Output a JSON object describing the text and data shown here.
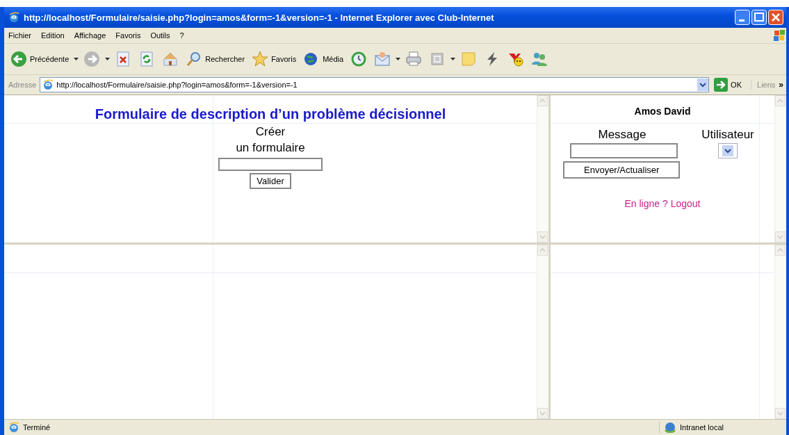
{
  "window": {
    "title": "http://localhost/Formulaire/saisie.php?login=amos&form=-1&version=-1 - Internet Explorer avec Club-Internet"
  },
  "menu": [
    "Fichier",
    "Edition",
    "Affichage",
    "Favoris",
    "Outils",
    "?"
  ],
  "toolbar": [
    {
      "kind": "back",
      "label": "Précédente",
      "menu_arrow": true
    },
    {
      "kind": "forward",
      "menu_arrow": true
    },
    {
      "kind": "stop"
    },
    {
      "kind": "refresh"
    },
    {
      "kind": "home"
    },
    {
      "kind": "search",
      "label": "Rechercher"
    },
    {
      "kind": "favorites",
      "label": "Favoris"
    },
    {
      "kind": "media",
      "label": "Média"
    },
    {
      "kind": "history"
    },
    {
      "kind": "mail",
      "menu_arrow": true
    },
    {
      "kind": "print"
    },
    {
      "kind": "edit",
      "menu_arrow": true
    },
    {
      "kind": "note"
    },
    {
      "kind": "bolt"
    },
    {
      "kind": "smiley"
    },
    {
      "kind": "people"
    }
  ],
  "address": {
    "label": "Adresse",
    "value": "http://localhost/Formulaire/saisie.php?login=amos&form=-1&version=-1",
    "go": "OK",
    "links": "Liens",
    "more": "»"
  },
  "form_frame": {
    "heading": "Formulaire de description d’un problème décisionnel",
    "prompt": [
      "Créer",
      "un formulaire"
    ],
    "button": "Valider"
  },
  "chat_frame": {
    "user": "Amos David",
    "message_label": "Message",
    "user_label": "Utilisateur",
    "send_button": "Envoyer/Actualiser",
    "status_link": "En ligne ? Logout"
  },
  "status_bar": {
    "text": "Terminé",
    "zone": "Intranet local"
  }
}
